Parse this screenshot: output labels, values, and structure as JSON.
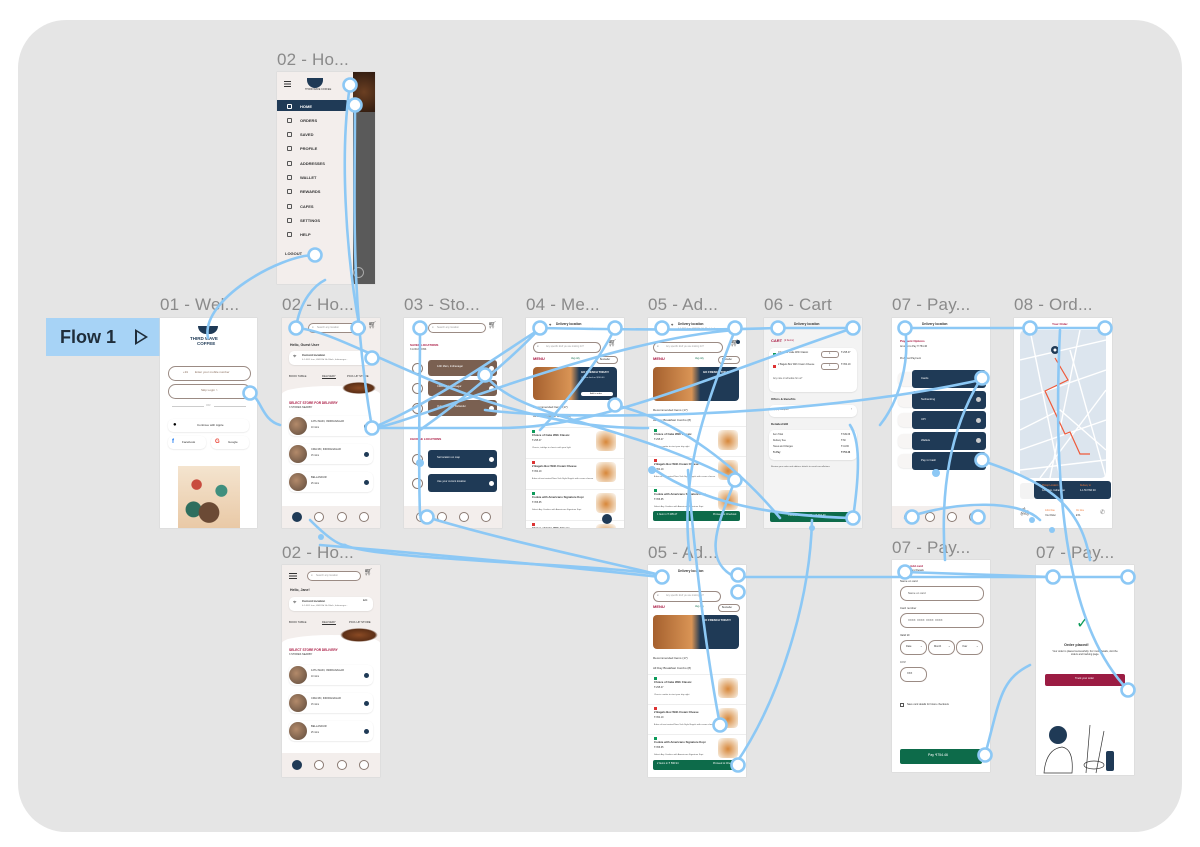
{
  "flow": {
    "label": "Flow 1",
    "play_icon": "play-icon"
  },
  "frames": {
    "drawer": {
      "label": "02 - Ho...",
      "menu": [
        "HOME",
        "ORDERS",
        "SAVED",
        "PROFILE",
        "ADDRESSES",
        "WALLET",
        "REWARDS",
        "CAFES",
        "SETTINGS",
        "HELP"
      ],
      "logout": "LOGOUT",
      "brand": "THIRD WAVE COFFEE"
    },
    "welcome": {
      "label": "01 - Wel...",
      "brand_line1": "THIRD WAVE",
      "brand_line2": "COFFEE",
      "phone_prefix": "+91",
      "phone_placeholder": "Enter your mobile number",
      "skip": "Skip Login >",
      "or": "OR",
      "apple": "Continue with Apple",
      "facebook": "Facebook",
      "google": "Google"
    },
    "home": {
      "label": "02 - Ho...",
      "search_placeholder": "Search any location",
      "greeting": "Hello, Guest User",
      "location_title": "Current location",
      "location_sub": "4-1-56/1 Icon, HSR Rd 5th Block, Indiranagar...",
      "tabs": [
        "BOOK TABLE",
        "DELIVERY",
        "PICK-UP STORE"
      ],
      "section_title": "SELECT STORE FOR DELIVERY",
      "section_sub": "3 STORES NEARBY",
      "stores": [
        {
          "name": "12TH MAIN, INDIRANAGAR",
          "time": "10 mins"
        },
        {
          "name": "CMH RD, INDIRANAGAR",
          "time": "15 mins"
        },
        {
          "name": "BELLANDUR",
          "time": "25 mins"
        }
      ]
    },
    "home2": {
      "label": "02 - Ho...",
      "search_placeholder": "Search any location",
      "greeting": "Hello, Jane!",
      "location_title": "Current location",
      "location_edit": "Edit",
      "location_sub": "4-1-56/1 Icon, HSR Rd 5th Block, Indiranagar...",
      "tabs": [
        "BOOK TABLE",
        "DELIVERY",
        "PICK-UP STORE"
      ],
      "section_title": "SELECT STORE FOR DELIVERY",
      "section_sub": "3 STORES NEARBY",
      "stores": [
        {
          "name": "12TH MAIN, INDIRANAGAR",
          "time": "10 mins"
        },
        {
          "name": "CMH RD, INDIRANAGAR",
          "time": "15 mins"
        },
        {
          "name": "BELLANDUR",
          "time": "25 mins"
        }
      ]
    },
    "stores": {
      "label": "03 - Sto...",
      "search_placeholder": "Search any location",
      "saved_title": "SAVED LOCATIONS",
      "saved_sub": "3 LOCATIONS",
      "saved": [
        "12th Main, Indiranagar",
        "CMH Rd, Indiranagar",
        "Outer Ring Rd, Bellandur"
      ],
      "other_title": "CHOOSE LOCATIONS",
      "other": [
        "Set location on map",
        "Use your current location"
      ]
    },
    "menu": {
      "label": "04 - Me...",
      "delivery": "Delivery location",
      "address": "4-1-56/1 Icon, HSR Rd, 5th Block, Indiranagar",
      "search_placeholder": "Any specific dish you are looking for?",
      "menu_title": "MENU",
      "veg": "Veg only",
      "bestseller": "Bestseller",
      "banner_title": "GO FRENCH TODAY!",
      "banner_sub": "Combo deal on $200.00",
      "banner_cta": "Add to order",
      "recommended": "Recommended Items (17)",
      "breakfast": "All Day Breakfast Combo (8)",
      "items": [
        {
          "name": "Choice of Cake With Classic",
          "price": "₹ 295.47",
          "desc": "Classic, indulge in classic with your light"
        },
        {
          "name": "2 Bagels Box With Cream Cheese",
          "price": "₹ 354.19",
          "desc": "A box of two toasted New York Style Bagels with cream cheese"
        },
        {
          "name": "Cookie with Americano Signature Kopi",
          "price": "₹ 356.95",
          "desc": "Select Any Cookies with Americano Signature Kopi"
        },
        {
          "name": "Choice of Cake With Classic",
          "price": "",
          "desc": ""
        }
      ]
    },
    "added": {
      "label": "05 - Ad...",
      "delivery": "Delivery location",
      "address": "4-1-56/1 Icon, HSR Rd, 5th Block, Indiranagar",
      "search_placeholder": "Any specific dish you are looking for?",
      "menu_title": "MENU",
      "veg": "Veg only",
      "bestseller": "Bestseller",
      "banner_title": "GO FRENCH TODAY!",
      "recommended": "Recommended Items (17)",
      "breakfast": "All Day Breakfast Combo (8)",
      "items": [
        {
          "name": "Choice of Cake With Classic",
          "price": "₹ 295.47",
          "desc": "Classic combo to start your day right"
        },
        {
          "name": "2 Bagels Box With Cream Cheese",
          "price": "₹ 354.19",
          "desc": "A box of two toasted New York Style Bagels with cream cheese"
        },
        {
          "name": "Cookie with Americano Signature Kopi",
          "price": "₹ 356.95",
          "desc": "Select Any Cookies with Americano Signature Kopi"
        }
      ],
      "checkout_items": "1 Item in ₹ 295.47",
      "checkout_cta": "Proceed to Checkout"
    },
    "added2": {
      "label": "05 - Ad...",
      "delivery": "Delivery location",
      "search_placeholder": "Any specific dish you are looking for?",
      "menu_title": "MENU",
      "veg": "Veg only",
      "bestseller": "Bestseller",
      "banner_title": "GO FRENCH TODAY!",
      "recommended": "Recommended Items (17)",
      "breakfast": "All Day Breakfast Combo (8)",
      "items": [
        {
          "name": "Choice of Cake With Classic",
          "price": "₹ 295.47",
          "desc": "Classic combo to start your day right"
        },
        {
          "name": "2 Bagels Box With Cream Cheese",
          "price": "₹ 354.19",
          "desc": "A box of two toasted New York Style Bagels with cream cheese"
        },
        {
          "name": "Cookie with Americano Signature Kopi",
          "price": "₹ 356.95",
          "desc": "Select Any Cookies with Americano Signature Kopi"
        }
      ],
      "checkout_items": "2 Items in ₹ 590.94",
      "checkout_cta": "Proceed to Checkout"
    },
    "cart": {
      "label": "06 - Cart",
      "delivery": "Delivery location",
      "title": "CART",
      "count": "(2 Items)",
      "lines": [
        {
          "name": "Choice of Cake With Classic",
          "qty": "1",
          "price": "₹ 295.47"
        },
        {
          "name": "2 Bagels Box With Cream Cheese",
          "qty": "1",
          "price": "₹ 354.19"
        }
      ],
      "schedule": "Any note or schedule for us?",
      "offers_title": "Offers & Benefits",
      "coupon": "Apply Coupon",
      "bill_title": "Detailed Bill",
      "bill": [
        {
          "k": "Item Total",
          "v": "₹ 649.66"
        },
        {
          "k": "Delivery Fee",
          "v": "₹ 60"
        },
        {
          "k": "Taxes and Charges",
          "v": "₹ 44.80"
        },
        {
          "k": "To Pay",
          "v": "₹ 754.46"
        }
      ],
      "note": "Review your order and address details to avoid cancellations",
      "cta": "Confirm Order and Pay ₹ 754.46"
    },
    "payment": {
      "label": "07 - Pay...",
      "delivery": "Delivery location",
      "options_title": "Payment Options",
      "amount": "Amount to Pay ₹ 754.46",
      "preferred": "Preferred Payment",
      "methods": [
        "Cards",
        "Netbanking",
        "UPI",
        "Wallets",
        "Pay in Cash"
      ]
    },
    "card": {
      "label": "07 - Pay...",
      "title": "Add card",
      "sub": "Card Details",
      "name_label": "Name on card",
      "name_placeholder": "Name on card",
      "number_label": "Card number",
      "number_placeholder": "XXXX  XXXX  XXXX  XXXX",
      "valid_label": "Valid till",
      "date": "Date",
      "month": "Month",
      "year": "Year",
      "cvv_label": "CVV",
      "cvv_placeholder": "XXX",
      "save": "Save card details for future checkouts",
      "pay": "Pay ₹754.46"
    },
    "tracking": {
      "label": "08 - Ord...",
      "title": "Your Order",
      "pickup_label": "Pickup Location",
      "pickup": "12th Main, Indiranagar",
      "dropoff_label": "Delivery to",
      "dropoff": "4-1-56 HSR Rd",
      "driver_label": "John Doe",
      "driver_sub": "Your Rider",
      "eta_label": "On time",
      "eta": "ETA"
    },
    "success": {
      "label": "07 - Pay...",
      "title": "Order placed!",
      "message": "Your order is placed successfully. For more details, visit the orders and tracking page.",
      "cta": "Track your order"
    }
  },
  "colors": {
    "canvas": "#e5e5e5",
    "flow": "#a7d3f6",
    "link": "#8cc8f5",
    "navy": "#1f3a56",
    "brown": "#7a6051",
    "green": "#0d6b4a",
    "maroon": "#9b1c43",
    "accent_red": "#a8153f"
  }
}
